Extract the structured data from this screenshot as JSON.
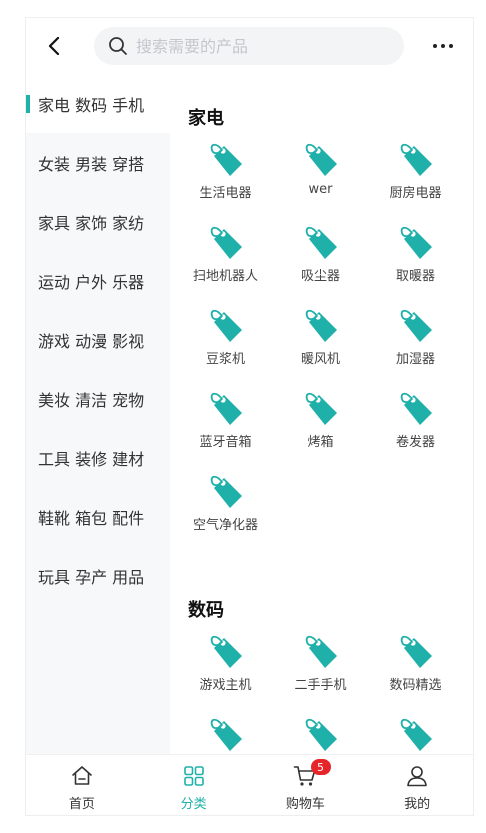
{
  "search": {
    "placeholder": "搜索需要的产品"
  },
  "colors": {
    "accent": "#1fb0aa",
    "badge": "#e5252a"
  },
  "sidebar": {
    "items": [
      {
        "label": "家电 数码 手机",
        "active": true
      },
      {
        "label": "女装 男装 穿搭"
      },
      {
        "label": "家具 家饰 家纺"
      },
      {
        "label": "运动 户外 乐器"
      },
      {
        "label": "游戏 动漫 影视"
      },
      {
        "label": "美妆 清洁 宠物"
      },
      {
        "label": "工具 装修 建材"
      },
      {
        "label": "鞋靴 箱包 配件"
      },
      {
        "label": "玩具 孕产 用品"
      }
    ]
  },
  "sections": [
    {
      "title": "家电",
      "items": [
        "生活电器",
        "wer",
        "厨房电器",
        "扫地机器人",
        "吸尘器",
        "取暖器",
        "豆浆机",
        "暖风机",
        "加湿器",
        "蓝牙音箱",
        "烤箱",
        "卷发器",
        "空气净化器"
      ]
    },
    {
      "title": "数码",
      "items": [
        "游戏主机",
        "二手手机",
        "数码精选",
        "",
        "",
        ""
      ]
    }
  ],
  "tabbar": {
    "tabs": [
      {
        "label": "首页",
        "icon": "home-icon"
      },
      {
        "label": "分类",
        "icon": "category-icon",
        "active": true
      },
      {
        "label": "购物车",
        "icon": "cart-icon",
        "badge": "5"
      },
      {
        "label": "我的",
        "icon": "user-icon"
      }
    ]
  }
}
